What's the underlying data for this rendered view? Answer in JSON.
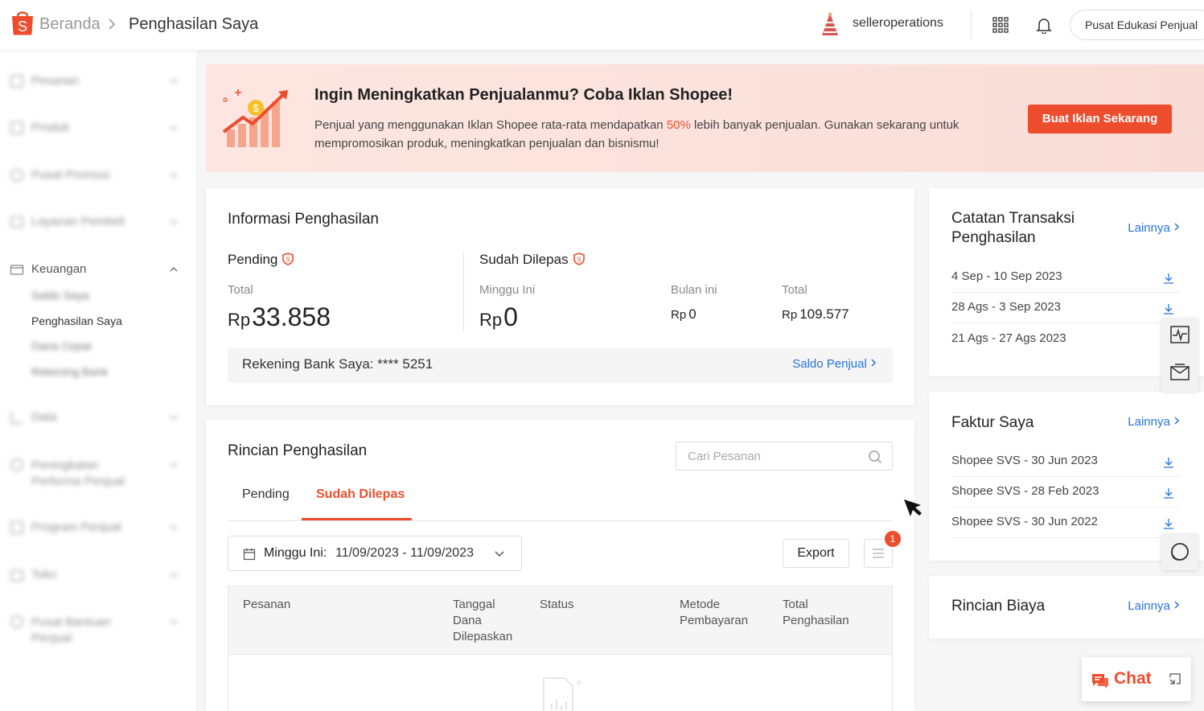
{
  "header": {
    "breadcrumb_home": "Beranda",
    "breadcrumb_current": "Penghasilan Saya",
    "username": "selleroperations",
    "edu_button": "Pusat Edukasi Penjual"
  },
  "sidebar": {
    "items": [
      {
        "label": "Pesanan"
      },
      {
        "label": "Produk"
      },
      {
        "label": "Pusat Promosi"
      },
      {
        "label": "Layanan Pembeli"
      },
      {
        "label": "Keuangan"
      },
      {
        "label": "Data"
      },
      {
        "label": "Peningkatan Performa Penjual"
      },
      {
        "label": "Program Penjual"
      },
      {
        "label": "Toko"
      },
      {
        "label": "Pusat Bantuan Penjual"
      }
    ],
    "keuangan_sub": [
      "Saldo Saya",
      "Penghasilan Saya",
      "Dana Cepat",
      "Rekening Bank"
    ]
  },
  "banner": {
    "title": "Ingin Meningkatkan Penjualanmu? Coba Iklan Shopee!",
    "text_before": "Penjual yang menggunakan Iklan Shopee rata-rata mendapatkan ",
    "highlight": "50%",
    "text_after": " lebih banyak penjualan. Gunakan sekarang untuk mempromosikan produk, meningkatkan penjualan dan bisnismu!",
    "button": "Buat Iklan Sekarang"
  },
  "info": {
    "title": "Informasi Penghasilan",
    "pending_label": "Pending",
    "total_label": "Total",
    "currency": "Rp",
    "pending_total": "33.858",
    "released_label": "Sudah Dilepas",
    "week_label": "Minggu Ini",
    "week_value": "0",
    "month_label": "Bulan ini",
    "month_value": "0",
    "released_total_label": "Total",
    "released_total": "109.577",
    "bank_text": "Rekening Bank Saya: **** 5251",
    "bank_link": "Saldo Penjual"
  },
  "rincian": {
    "title": "Rincian Penghasilan",
    "search_placeholder": "Cari Pesanan",
    "tabs": [
      "Pending",
      "Sudah Dilepas"
    ],
    "active_tab": "Sudah Dilepas",
    "date_label": "Minggu Ini:",
    "date_value": "11/09/2023 - 11/09/2023",
    "export": "Export",
    "badge_count": "1",
    "columns": {
      "pesanan": "Pesanan",
      "tanggal": [
        "Tanggal",
        "Dana",
        "Dilepaskan"
      ],
      "status": "Status",
      "metode": [
        "Metode",
        "Pembayaran"
      ],
      "total": [
        "Total",
        "Penghasilan"
      ]
    }
  },
  "catatan": {
    "title_line1": "Catatan Transaksi",
    "title_line2": "Penghasilan",
    "more": "Lainnya",
    "rows": [
      "4 Sep - 10 Sep 2023",
      "28 Ags - 3 Sep 2023",
      "21 Ags - 27 Ags 2023"
    ]
  },
  "faktur": {
    "title": "Faktur Saya",
    "more": "Lainnya",
    "rows": [
      "Shopee SVS - 30 Jun 2023",
      "Shopee SVS - 28 Feb 2023",
      "Shopee SVS - 30 Jun 2022"
    ]
  },
  "biaya": {
    "title": "Rincian Biaya",
    "more": "Lainnya"
  },
  "chat": {
    "label": "Chat"
  },
  "colors": {
    "accent": "#ee4d2d",
    "link": "#2673dd"
  }
}
